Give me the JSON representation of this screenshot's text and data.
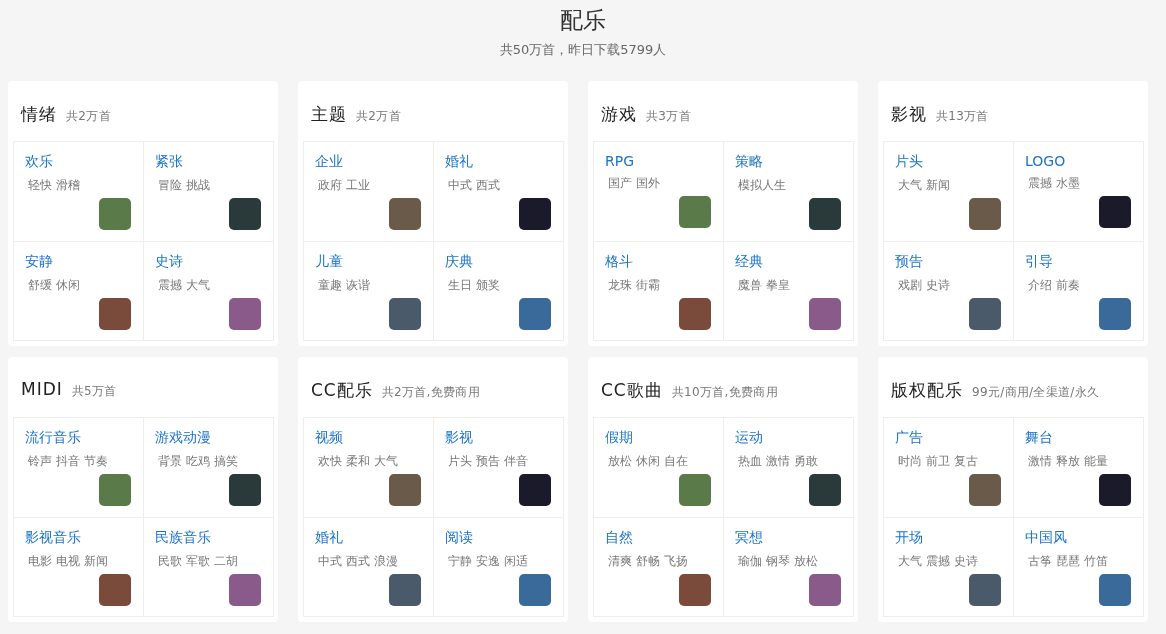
{
  "header": {
    "title": "配乐",
    "subtitle": "共50万首，昨日下载5799人"
  },
  "categories": [
    {
      "name": "情绪",
      "note": "共2万首",
      "items": [
        {
          "title": "欢乐",
          "tags": "轻快 滑稽"
        },
        {
          "title": "紧张",
          "tags": "冒险 挑战"
        },
        {
          "title": "安静",
          "tags": "舒缓 休闲"
        },
        {
          "title": "史诗",
          "tags": "震撼 大气"
        }
      ]
    },
    {
      "name": "主题",
      "note": "共2万首",
      "items": [
        {
          "title": "企业",
          "tags": "政府 工业"
        },
        {
          "title": "婚礼",
          "tags": "中式 西式"
        },
        {
          "title": "儿童",
          "tags": "童趣 诙谐"
        },
        {
          "title": "庆典",
          "tags": "生日 颁奖"
        }
      ]
    },
    {
      "name": "游戏",
      "note": "共3万首",
      "items": [
        {
          "title": "RPG",
          "tags": "国产 国外"
        },
        {
          "title": "策略",
          "tags": "模拟人生"
        },
        {
          "title": "格斗",
          "tags": "龙珠 街霸"
        },
        {
          "title": "经典",
          "tags": "魔兽 拳皇"
        }
      ]
    },
    {
      "name": "影视",
      "note": "共13万首",
      "items": [
        {
          "title": "片头",
          "tags": "大气 新闻"
        },
        {
          "title": "LOGO",
          "tags": "震撼 水墨"
        },
        {
          "title": "预告",
          "tags": "戏剧 史诗"
        },
        {
          "title": "引导",
          "tags": "介绍 前奏"
        }
      ]
    },
    {
      "name": "MIDI",
      "note": "共5万首",
      "items": [
        {
          "title": "流行音乐",
          "tags": "铃声 抖音 节奏"
        },
        {
          "title": "游戏动漫",
          "tags": "背景 吃鸡 搞笑"
        },
        {
          "title": "影视音乐",
          "tags": "电影 电视 新闻"
        },
        {
          "title": "民族音乐",
          "tags": "民歌 军歌 二胡"
        }
      ]
    },
    {
      "name": "CC配乐",
      "note": "共2万首,免费商用",
      "items": [
        {
          "title": "视频",
          "tags": "欢快 柔和 大气"
        },
        {
          "title": "影视",
          "tags": "片头 预告 伴音"
        },
        {
          "title": "婚礼",
          "tags": "中式 西式 浪漫"
        },
        {
          "title": "阅读",
          "tags": "宁静 安逸 闲适"
        }
      ]
    },
    {
      "name": "CC歌曲",
      "note": "共10万首,免费商用",
      "items": [
        {
          "title": "假期",
          "tags": "放松 休闲 自在"
        },
        {
          "title": "运动",
          "tags": "热血 激情 勇敢"
        },
        {
          "title": "自然",
          "tags": "清爽 舒畅 飞扬"
        },
        {
          "title": "冥想",
          "tags": "瑜伽 钢琴 放松"
        }
      ]
    },
    {
      "name": "版权配乐",
      "note": "99元/商用/全渠道/永久",
      "items": [
        {
          "title": "广告",
          "tags": "时尚 前卫 复古"
        },
        {
          "title": "舞台",
          "tags": "激情 释放 能量"
        },
        {
          "title": "开场",
          "tags": "大气 震撼 史诗"
        },
        {
          "title": "中国风",
          "tags": "古筝 琵琶 竹笛"
        }
      ]
    }
  ]
}
